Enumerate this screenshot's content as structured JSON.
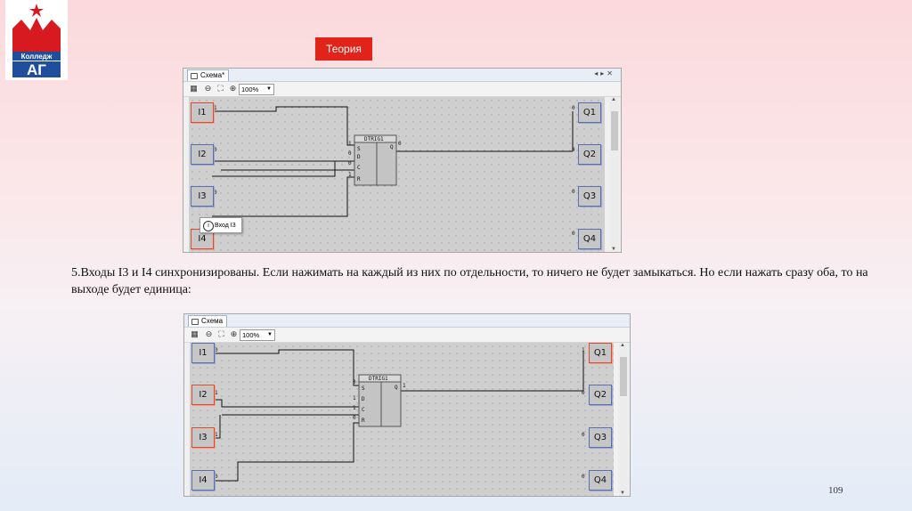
{
  "logo": {
    "text": "Колледж",
    "letters": "АГ"
  },
  "theory_button": "Теория",
  "screen1": {
    "tab_title": "Схема*",
    "zoom": "100%",
    "inputs": [
      {
        "label": "I1",
        "value": "1",
        "active": true
      },
      {
        "label": "I2",
        "value": "0",
        "active": false
      },
      {
        "label": "I3",
        "value": "0",
        "active": false
      },
      {
        "label": "I4",
        "value": "",
        "active": true
      }
    ],
    "outputs": [
      {
        "label": "Q1",
        "value": "0"
      },
      {
        "label": "Q2",
        "value": "0"
      },
      {
        "label": "Q3",
        "value": "0"
      },
      {
        "label": "Q4",
        "value": "0"
      }
    ],
    "block": {
      "name": "DTRIG1",
      "pins": [
        "S",
        "D",
        "C",
        "R"
      ],
      "pin_values": [
        "1",
        "0",
        "0",
        "1"
      ],
      "out_pin": "Q",
      "out_value": "0"
    },
    "tooltip": "Вход I3"
  },
  "description": "5.Входы I3 и I4 синхронизированы. Если нажимать на каждый из них по отдельности, то ничего не будет замыкаться. Но если нажать сразу оба, то на выходе будет единица:",
  "screen2": {
    "tab_title": "Схема",
    "zoom": "100%",
    "inputs": [
      {
        "label": "I1",
        "value": "0",
        "active": false
      },
      {
        "label": "I2",
        "value": "1",
        "active": true
      },
      {
        "label": "I3",
        "value": "1",
        "active": true
      },
      {
        "label": "I4",
        "value": "0",
        "active": false
      }
    ],
    "outputs": [
      {
        "label": "Q1",
        "value": "1"
      },
      {
        "label": "Q2",
        "value": "0"
      },
      {
        "label": "Q3",
        "value": "0"
      },
      {
        "label": "Q4",
        "value": "0"
      }
    ],
    "block": {
      "name": "DTRIG1",
      "pins": [
        "S",
        "D",
        "C",
        "R"
      ],
      "pin_values": [
        "0",
        "1",
        "1",
        "0"
      ],
      "out_pin": "Q",
      "out_value": "1"
    }
  },
  "page_number": "109",
  "colors": {
    "accent": "#e2231a",
    "active_border": "#e0482a",
    "io_border": "#5a6fb0"
  }
}
